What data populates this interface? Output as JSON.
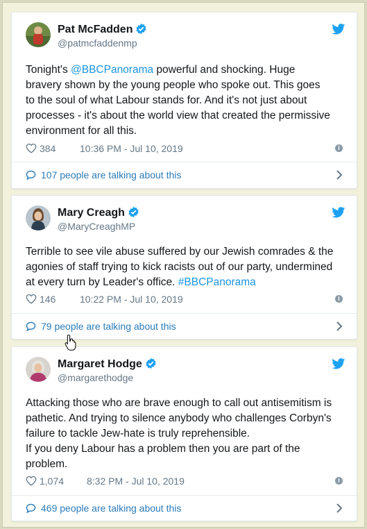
{
  "tweets": [
    {
      "name": "Pat McFadden",
      "handle": "@patmcfaddenmp",
      "text_parts": [
        "Tonight's ",
        "@BBCPanorama",
        " powerful and shocking.  Huge\nbravery shown by the young people who spoke out.  This goes\nto the soul of what Labour stands for.  And it's not just about\nprocesses - it's about the world view that created the permissive\nenvironment for all this."
      ],
      "likes": "384",
      "time": "10:36 PM - Jul 10, 2019",
      "talking": "107 people are talking about this"
    },
    {
      "name": "Mary Creagh",
      "handle": "@MaryCreaghMP",
      "text_parts": [
        "Terrible to see vile abuse suffered by our Jewish comrades & the\nagonies of staff trying to kick racists out of our party, undermined\nat every turn by Leader's office. ",
        "#BBCPanorama",
        ""
      ],
      "likes": "146",
      "time": "10:22 PM - Jul 10, 2019",
      "talking": "79 people are talking about this"
    },
    {
      "name": "Margaret Hodge",
      "handle": "@margarethodge",
      "text_parts": [
        "Attacking those who are brave enough to call out antisemitism is\npathetic. And trying to silence anybody who challenges Corbyn's\nfailure to tackle Jew-hate is truly reprehensible.\nIf you deny Labour has a problem then you are part of the\nproblem.",
        "",
        ""
      ],
      "likes": "1,074",
      "time": "8:32 PM - Jul 10, 2019",
      "talking": "469 people are talking about this"
    }
  ],
  "colors": {
    "link": "#1b95e0",
    "talk": "#2b7bb9",
    "meta": "#657786",
    "verified": "#1da1f2"
  },
  "icons": [
    "verified-badge-icon",
    "twitter-bird-icon",
    "heart-icon",
    "info-icon",
    "speech-bubble-icon",
    "chevron-right-icon",
    "hand-cursor-icon"
  ]
}
